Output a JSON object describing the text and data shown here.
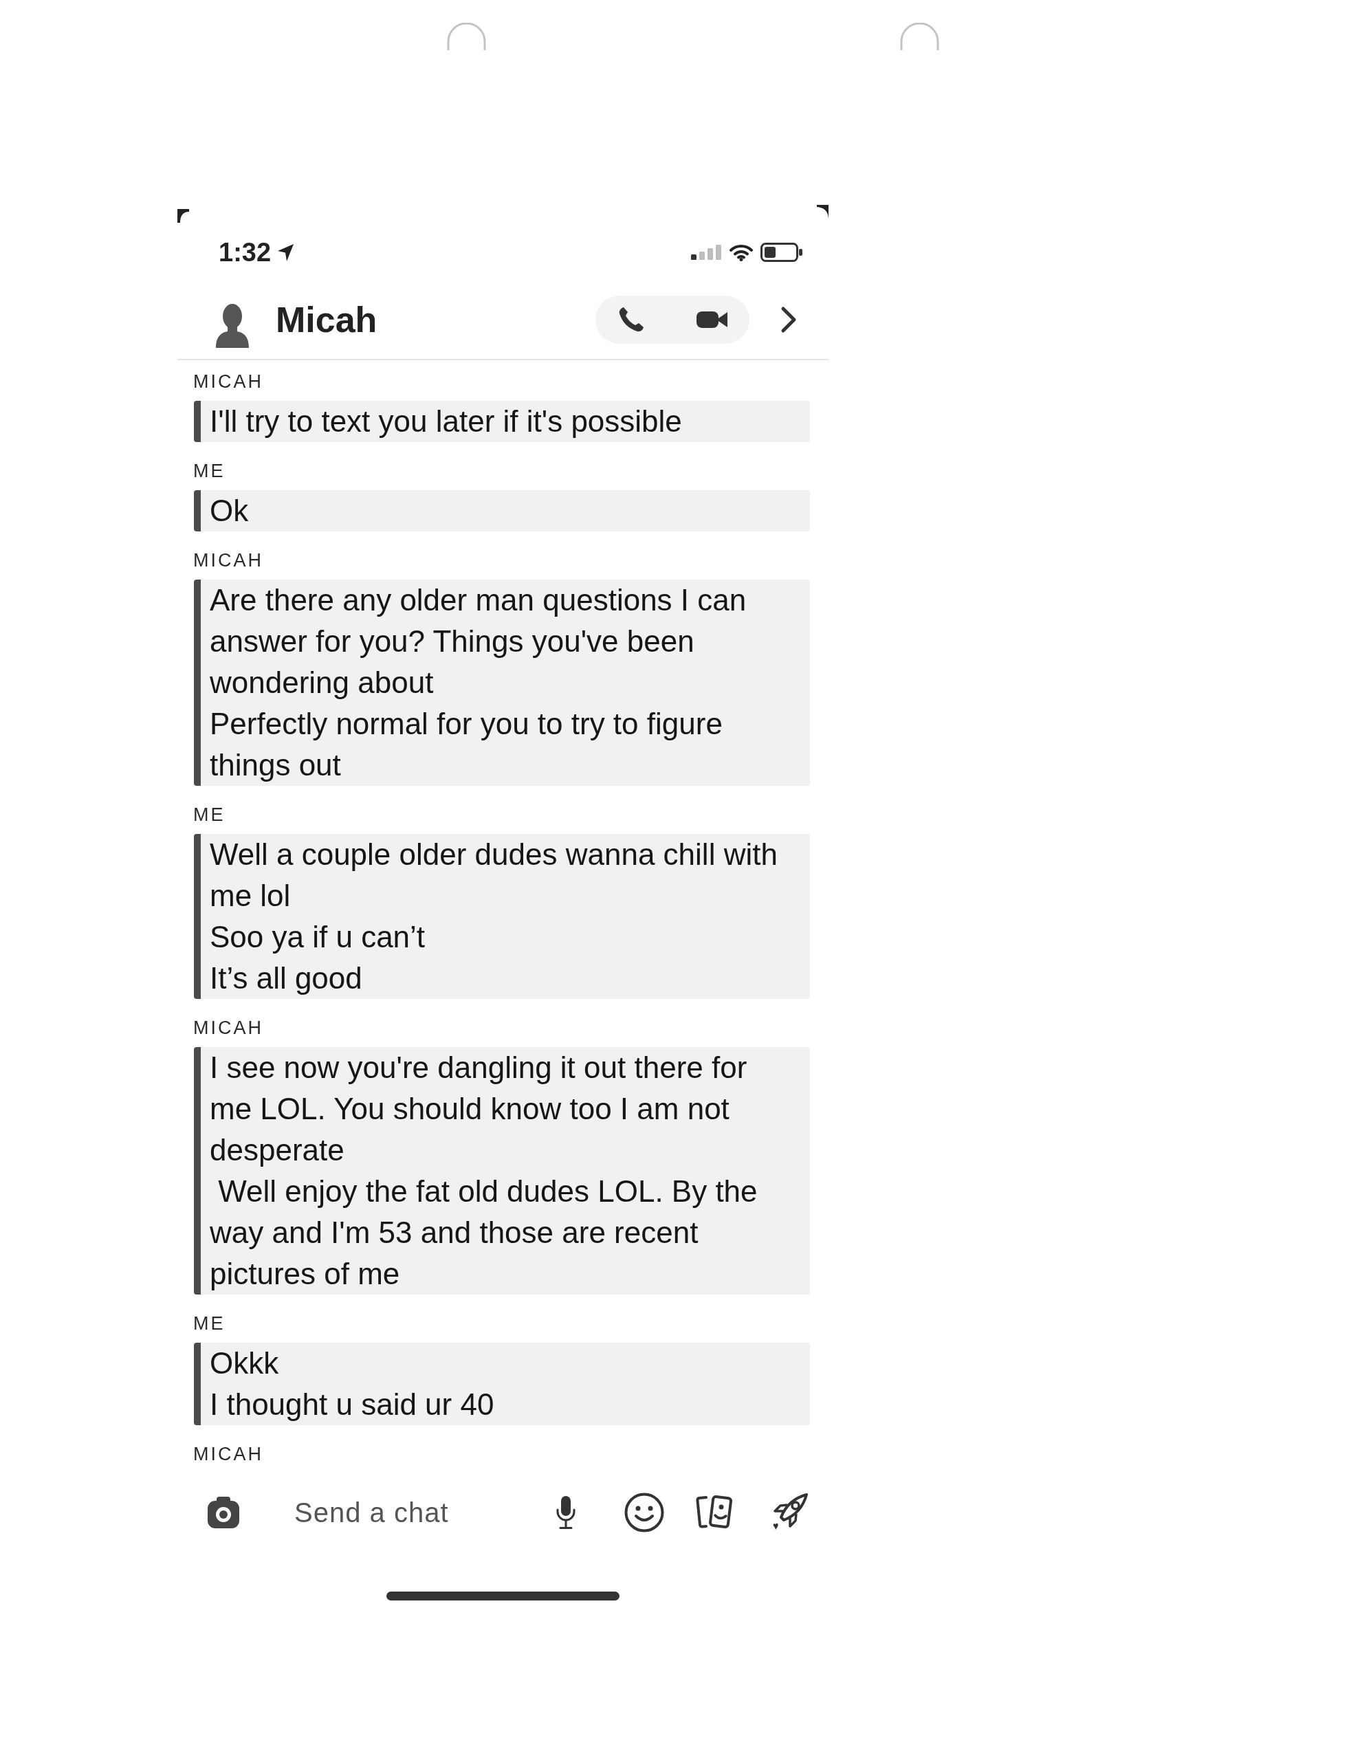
{
  "status_bar": {
    "time": "1:32"
  },
  "header": {
    "title": "Micah"
  },
  "messages": [
    {
      "sender": "MICAH",
      "saved": true,
      "lines": [
        "I'll try to text you later if it's possible"
      ]
    },
    {
      "sender": "ME",
      "saved": true,
      "lines": [
        "Ok"
      ]
    },
    {
      "sender": "MICAH",
      "saved": true,
      "lines": [
        "Are there any older man questions I can answer for you? Things you've been wondering about",
        "Perfectly normal for you to try to figure things out"
      ]
    },
    {
      "sender": "ME",
      "saved": true,
      "lines": [
        "Well a couple older dudes wanna chill with me lol",
        "Soo ya if u can’t",
        "It’s all good"
      ]
    },
    {
      "sender": "MICAH",
      "saved": true,
      "lines": [
        "I see now you're dangling it out there for me LOL. You should know too I am not desperate",
        " Well enjoy the fat old dudes LOL. By the way and I'm 53 and those are recent pictures of me"
      ]
    },
    {
      "sender": "ME",
      "saved": true,
      "lines": [
        "Okkk",
        "I thought u said ur 40"
      ]
    },
    {
      "sender": "MICAH"
    }
  ],
  "composer": {
    "placeholder": "Send a chat"
  }
}
